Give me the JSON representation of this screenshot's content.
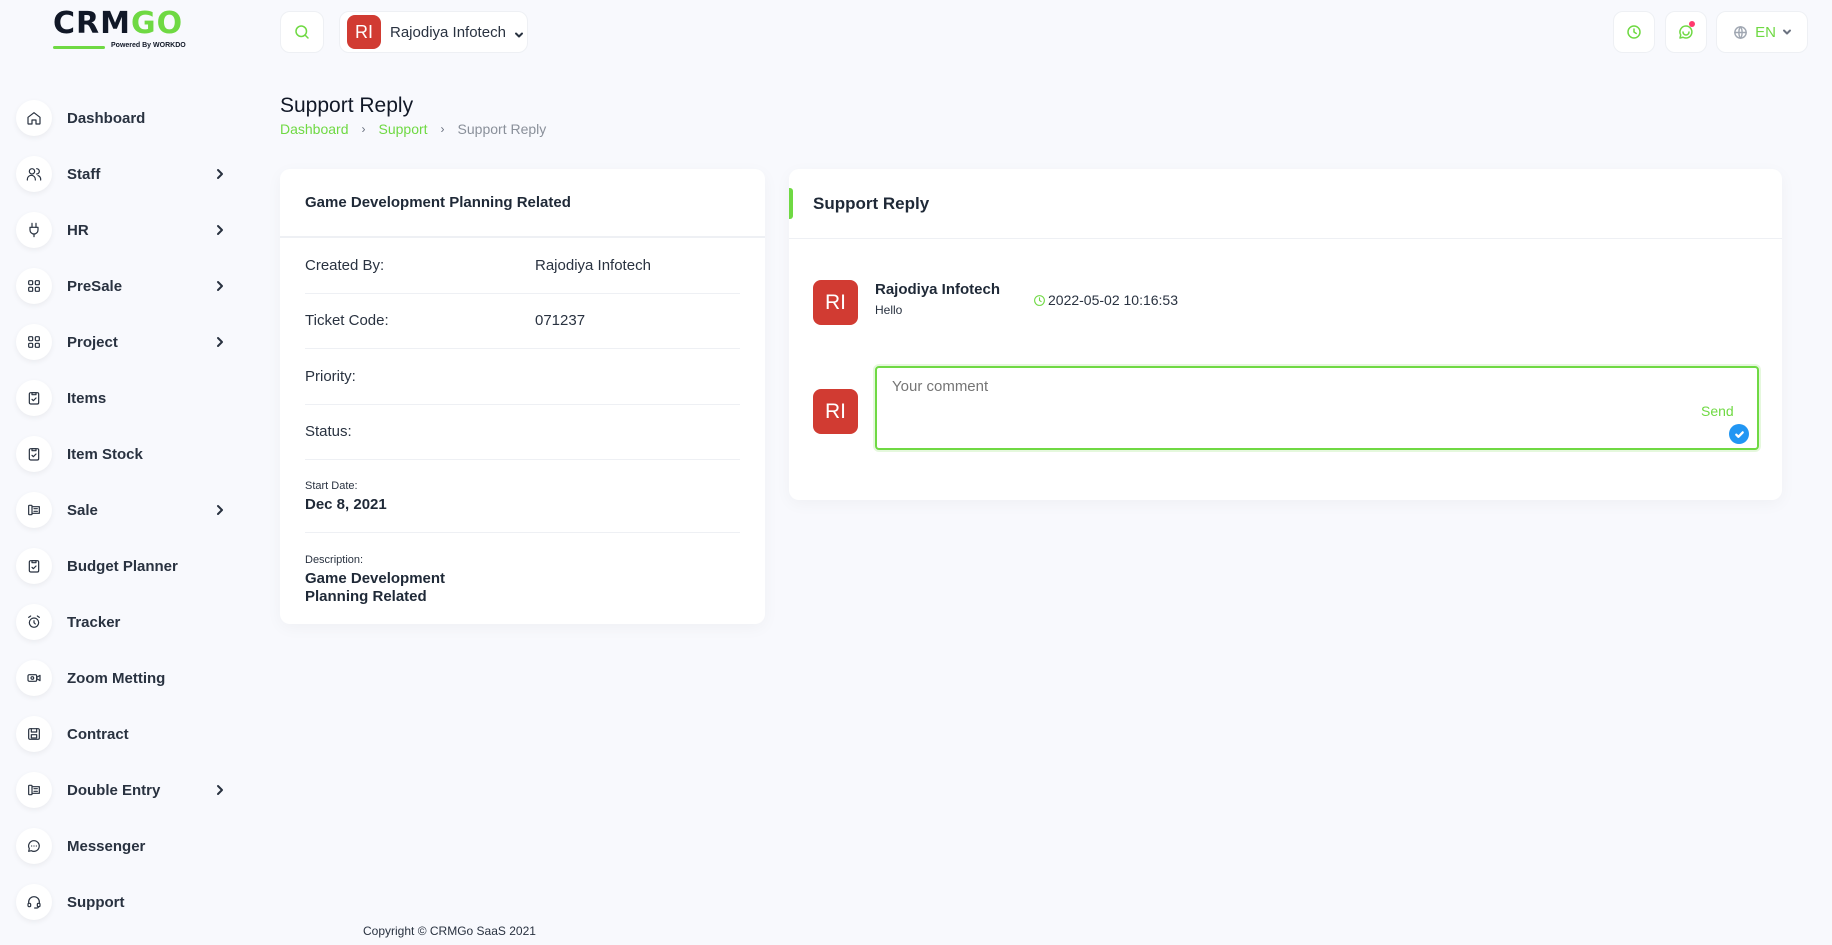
{
  "brand": {
    "logo_text_main": "CRM",
    "logo_text_accent": "GO",
    "logo_sub": "Powered By",
    "logo_sub_brand": "WORKDO"
  },
  "sidebar": {
    "items": [
      {
        "label": "Dashboard",
        "icon": "home-icon",
        "has_children": false
      },
      {
        "label": "Staff",
        "icon": "users-icon",
        "has_children": true
      },
      {
        "label": "HR",
        "icon": "plug-icon",
        "has_children": true
      },
      {
        "label": "PreSale",
        "icon": "grid-icon",
        "has_children": true
      },
      {
        "label": "Project",
        "icon": "grid-icon",
        "has_children": true
      },
      {
        "label": "Items",
        "icon": "clipboard-icon",
        "has_children": false
      },
      {
        "label": "Item Stock",
        "icon": "clipboard-icon",
        "has_children": false
      },
      {
        "label": "Sale",
        "icon": "receipt-icon",
        "has_children": true
      },
      {
        "label": "Budget Planner",
        "icon": "clipboard-icon",
        "has_children": false
      },
      {
        "label": "Tracker",
        "icon": "alarm-clock-icon",
        "has_children": false
      },
      {
        "label": "Zoom Metting",
        "icon": "video-icon",
        "has_children": false
      },
      {
        "label": "Contract",
        "icon": "save-icon",
        "has_children": false
      },
      {
        "label": "Double Entry",
        "icon": "receipt-icon",
        "has_children": true
      },
      {
        "label": "Messenger",
        "icon": "chat-icon",
        "has_children": false
      },
      {
        "label": "Support",
        "icon": "headset-icon",
        "has_children": false
      }
    ]
  },
  "header": {
    "workspace_initials": "RI",
    "workspace_name": "Rajodiya Infotech",
    "language": "EN"
  },
  "page": {
    "title": "Support Reply",
    "breadcrumb": [
      "Dashboard",
      "Support",
      "Support Reply"
    ]
  },
  "ticket": {
    "title": "Game Development Planning Related",
    "created_by_label": "Created By:",
    "created_by": "Rajodiya Infotech",
    "code_label": "Ticket Code:",
    "code": "071237",
    "priority_label": "Priority:",
    "priority": "",
    "status_label": "Status:",
    "status": "",
    "start_date_label": "Start Date:",
    "start_date": "Dec 8, 2021",
    "description_label": "Description:",
    "description": "Game Development Planning Related"
  },
  "reply": {
    "title": "Support Reply",
    "messages": [
      {
        "initials": "RI",
        "author": "Rajodiya Infotech",
        "text": "Hello",
        "time": "2022-05-02 10:16:53"
      }
    ],
    "current_user_initials": "RI",
    "comment_placeholder": "Your comment",
    "send_label": "Send"
  },
  "footer": {
    "copyright": "Copyright © CRMGo SaaS 2021"
  },
  "colors": {
    "accent": "#6fd943",
    "avatar": "#d13b32",
    "notification_dot": "#ff3a6e",
    "check_badge": "#2196f3"
  }
}
